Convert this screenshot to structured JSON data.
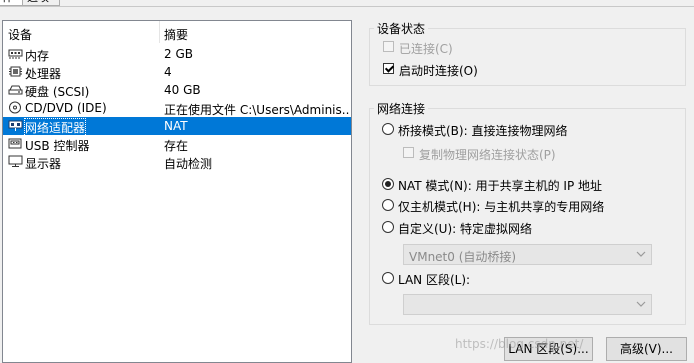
{
  "tabs": [
    {
      "label": "件"
    },
    {
      "label": "选项"
    }
  ],
  "device_list": {
    "headers": {
      "device": "设备",
      "summary": "摘要"
    },
    "rows": [
      {
        "icon": "memory-icon",
        "name": "内存",
        "summary": "2 GB"
      },
      {
        "icon": "processor-icon",
        "name": "处理器",
        "summary": "4"
      },
      {
        "icon": "hard-disk-icon",
        "name": "硬盘 (SCSI)",
        "summary": "40 GB"
      },
      {
        "icon": "cd-dvd-icon",
        "name": "CD/DVD (IDE)",
        "summary": "正在使用文件 C:\\Users\\Adminis..."
      },
      {
        "icon": "network-adapter-icon",
        "name": "网络适配器",
        "summary": "NAT",
        "selected": true
      },
      {
        "icon": "usb-icon",
        "name": "USB 控制器",
        "summary": "存在"
      },
      {
        "icon": "display-icon",
        "name": "显示器",
        "summary": "自动检测"
      }
    ]
  },
  "device_status": {
    "title": "设备状态",
    "connected": {
      "label": "已连接(C)",
      "checked": false,
      "enabled": false
    },
    "connect_at_power_on": {
      "label": "启动时连接(O)",
      "checked": true,
      "enabled": true
    }
  },
  "network_connection": {
    "title": "网络连接",
    "bridged": {
      "label": "桥接模式(B): 直接连接物理网络",
      "checked": false
    },
    "replicate": {
      "label": "复制物理网络连接状态(P)",
      "checked": false,
      "enabled": false
    },
    "nat": {
      "label": "NAT 模式(N): 用于共享主机的 IP 地址",
      "checked": true
    },
    "host_only": {
      "label": "仅主机模式(H): 与主机共享的专用网络",
      "checked": false
    },
    "custom": {
      "label": "自定义(U): 特定虚拟网络",
      "checked": false
    },
    "custom_select": {
      "value": "VMnet0 (自动桥接)"
    },
    "lan_segment": {
      "label": "LAN 区段(L):",
      "checked": false
    },
    "lan_select": {
      "value": ""
    }
  },
  "buttons": {
    "lan_segments": "LAN 区段(S)...",
    "advanced": "高级(V)..."
  },
  "watermark": "https://blog.csdn.net/"
}
